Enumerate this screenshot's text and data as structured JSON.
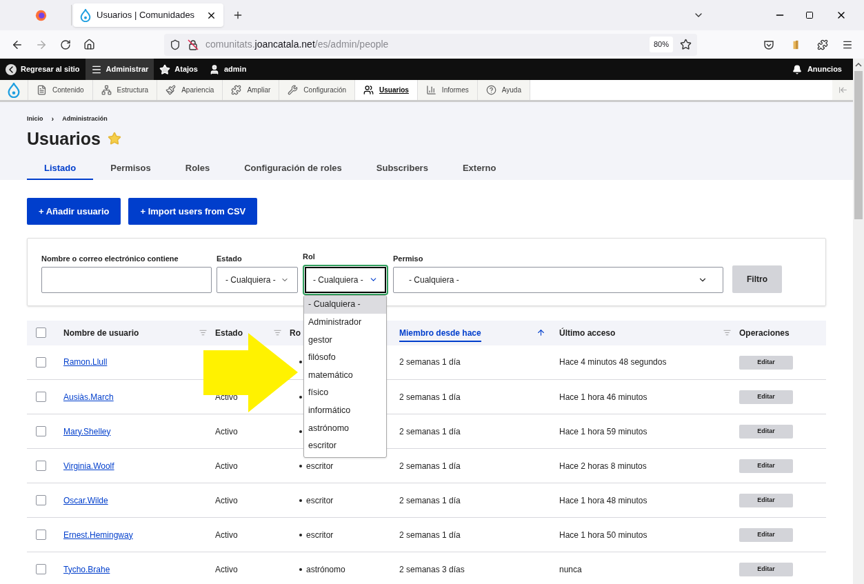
{
  "browser": {
    "tab_title": "Usuarios | Comunidades",
    "url_prefix": "comunitats.",
    "url_domain": "joancatala.net",
    "url_path": "/es/admin/people",
    "zoom": "80%"
  },
  "toolbar": {
    "items": [
      {
        "label": "Regresar al sitio",
        "selected": false
      },
      {
        "label": "Administrar",
        "selected": true
      },
      {
        "label": "Atajos",
        "selected": false
      },
      {
        "label": "admin",
        "selected": false
      }
    ],
    "announcements": "Anuncios"
  },
  "tray": [
    {
      "label": "Contenido",
      "selected": false
    },
    {
      "label": "Estructura",
      "selected": false
    },
    {
      "label": "Apariencia",
      "selected": false
    },
    {
      "label": "Ampliar",
      "selected": false
    },
    {
      "label": "Configuración",
      "selected": false
    },
    {
      "label": "Usuarios",
      "selected": true
    },
    {
      "label": "Informes",
      "selected": false
    },
    {
      "label": "Ayuda",
      "selected": false
    }
  ],
  "breadcrumb": [
    "Inicio",
    "Administración"
  ],
  "breadcrumb_separator": "›",
  "title": "Usuarios",
  "tabs": [
    {
      "label": "Listado",
      "selected": true
    },
    {
      "label": "Permisos",
      "selected": false
    },
    {
      "label": "Roles",
      "selected": false
    },
    {
      "label": "Configuración de roles",
      "selected": false
    },
    {
      "label": "Subscribers",
      "selected": false
    },
    {
      "label": "Externo",
      "selected": false
    }
  ],
  "actions": [
    "+ Añadir usuario",
    "+ Import users from CSV"
  ],
  "filters": {
    "name_label": "Nombre o correo electrónico contiene",
    "status_label": "Estado",
    "status_value": "- Cualquiera -",
    "role_label": "Rol",
    "role_value": "- Cualquiera -",
    "permission_label": "Permiso",
    "permission_value": "- Cualquiera -",
    "submit": "Filtro"
  },
  "role_options": [
    {
      "label": "- Cualquiera -",
      "selected": true
    },
    {
      "label": "Administrador",
      "selected": false
    },
    {
      "label": "gestor",
      "selected": false
    },
    {
      "label": "filósofo",
      "selected": false
    },
    {
      "label": "matemático",
      "selected": false
    },
    {
      "label": "físico",
      "selected": false
    },
    {
      "label": "informático",
      "selected": false
    },
    {
      "label": "astrónomo",
      "selected": false
    },
    {
      "label": "escritor",
      "selected": false
    }
  ],
  "table": {
    "select_all_checked": false,
    "columns": [
      {
        "label": "Nombre de usuario",
        "kind": "sortable"
      },
      {
        "label": "Estado",
        "kind": "sortable"
      },
      {
        "label": "Ro",
        "kind": "plain"
      },
      {
        "label": "Miembro desde hace",
        "kind": "sorted"
      },
      {
        "label": "Último acceso",
        "kind": "sortable"
      },
      {
        "label": "Operaciones",
        "kind": "plain"
      }
    ],
    "rows": [
      {
        "checked": false,
        "name": "Ramon.Llull",
        "member": "2 semanas 1 día",
        "access": "Hace 4 minutos 48 segundos",
        "op": "Editar"
      },
      {
        "checked": false,
        "name": "Ausiàs.March",
        "status": "Activo",
        "member": "2 semanas 1 día",
        "access": "Hace 1 hora 46 minutos",
        "op": "Editar"
      },
      {
        "checked": false,
        "name": "Mary.Shelley",
        "status": "Activo",
        "member": "2 semanas 1 día",
        "access": "Hace 1 hora 59 minutos",
        "op": "Editar"
      },
      {
        "checked": false,
        "name": "Virginia.Woolf",
        "status": "Activo",
        "role": "escritor",
        "member": "2 semanas 1 día",
        "access": "Hace 2 horas 8 minutos",
        "op": "Editar"
      },
      {
        "checked": false,
        "name": "Oscar.Wilde",
        "status": "Activo",
        "role": "escritor",
        "member": "2 semanas 1 día",
        "access": "Hace 1 hora 48 minutos",
        "op": "Editar"
      },
      {
        "checked": false,
        "name": "Ernest.Hemingway",
        "status": "Activo",
        "role": "escritor",
        "member": "2 semanas 1 día",
        "access": "Hace 1 hora 50 minutos",
        "op": "Editar"
      },
      {
        "checked": false,
        "name": "Tycho.Brahe",
        "status": "Activo",
        "role": "astrónomo",
        "member": "2 semanas 3 días",
        "access": "nunca",
        "op": "Editar"
      }
    ]
  }
}
